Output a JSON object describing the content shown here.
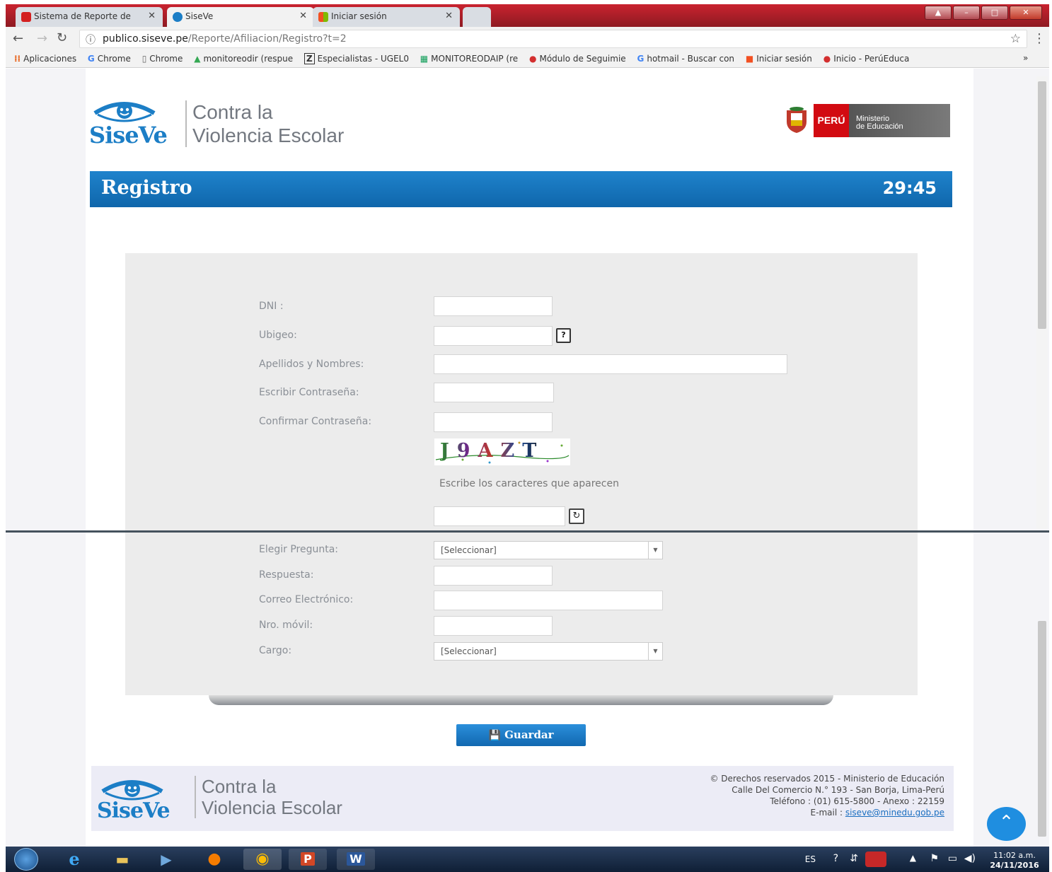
{
  "browser": {
    "tabs": [
      {
        "title": "Sistema de Reporte de",
        "icon": "youtube-icon",
        "color": "#d32020"
      },
      {
        "title": "SiseVe",
        "icon": "siseve-icon",
        "color": "#1c7ec6"
      },
      {
        "title": "Iniciar sesión",
        "icon": "windows-icon",
        "color": "#f25022"
      }
    ],
    "url_host": "publico.siseve.pe",
    "url_path": "/Reporte/Afiliacion/Registro?t=2",
    "bookmarks": [
      {
        "label": "Aplicaciones",
        "icon": "apps-icon"
      },
      {
        "label": "Chrome",
        "icon": "google-icon"
      },
      {
        "label": "Chrome",
        "icon": "page-icon"
      },
      {
        "label": "monitoreodir (respue",
        "icon": "drive-icon"
      },
      {
        "label": "Especialistas - UGEL0",
        "icon": "z-icon"
      },
      {
        "label": "MONITOREODAIP (re",
        "icon": "sheets-icon"
      },
      {
        "label": "Módulo de Seguimie",
        "icon": "module-icon"
      },
      {
        "label": "hotmail - Buscar con",
        "icon": "google-icon"
      },
      {
        "label": "Iniciar sesión",
        "icon": "windows-icon"
      },
      {
        "label": "Inicio - PerúEduca",
        "icon": "peru-icon"
      }
    ],
    "more_bookmarks": "»"
  },
  "header": {
    "logo_text": "SiseVe",
    "tagline_line1": "Contra la",
    "tagline_line2": "Violencia Escolar",
    "peru_label": "PERÚ",
    "ministry_line1": "Ministerio",
    "ministry_line2": "de Educación"
  },
  "banner": {
    "title": "Registro",
    "timer": "29:45"
  },
  "form": {
    "dni_label": "DNI :",
    "ubigeo_label": "Ubigeo:",
    "ubigeo_help": "?",
    "names_label": "Apellidos y Nombres:",
    "password_label": "Escribir Contraseña:",
    "confirm_label": "Confirmar Contraseña:",
    "captcha_text": "J9AZT",
    "captcha_hint": "Escribe los caracteres que aparecen",
    "question_label": "Elegir Pregunta:",
    "question_value": "[Seleccionar]",
    "answer_label": "Respuesta:",
    "email_label": "Correo Electrónico:",
    "mobile_label": "Nro. móvil:",
    "role_label": "Cargo:",
    "role_value": "[Seleccionar]",
    "save_label": "Guardar"
  },
  "footer": {
    "logo_text": "SiseVe",
    "tagline_line1": "Contra la",
    "tagline_line2": "Violencia Escolar",
    "copyright": "© Derechos reservados 2015 - Ministerio de Educación",
    "address": "Calle Del Comercio N.° 193 - San Borja, Lima-Perú",
    "phone": "Teléfono : (01) 615-5800 - Anexo : 22159",
    "email_prefix": "E-mail : ",
    "email": "siseve@minedu.gob.pe"
  },
  "taskbar": {
    "language": "ES",
    "time": "11:02 a.m.",
    "date": "24/11/2016"
  },
  "colors": {
    "brand_blue": "#1c7ec6",
    "peru_red": "#d20a11",
    "ministry_gray": "#5f5f5f"
  }
}
